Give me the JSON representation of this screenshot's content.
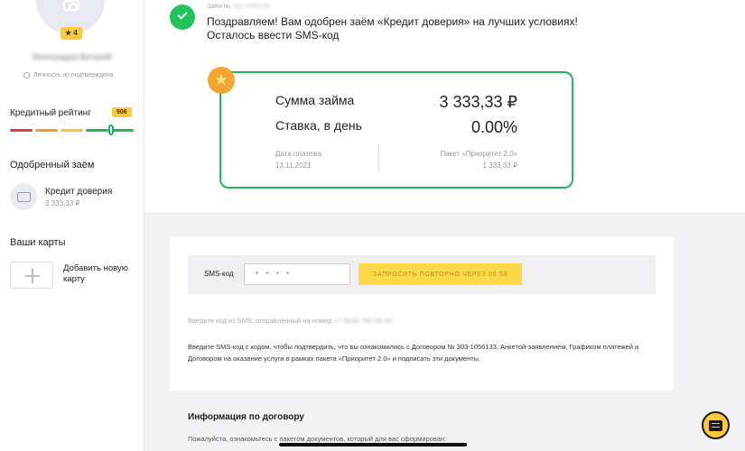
{
  "sidebar": {
    "rating_stars": "★ 4",
    "user_name": "Виноградов Виталий",
    "verify_status": "Личность не подтверждена",
    "credit_rating": {
      "label": "Кредитный рейтинг",
      "value": "906",
      "level": 0.82
    },
    "rating_colors": [
      "#e23b3b",
      "#f39a2b",
      "#f6c33a",
      "#22b85a",
      "#22b85a"
    ],
    "approved_section": "Одобренный заём",
    "approved_loan": {
      "name": "Кредит доверия",
      "amount": "3 333,33 ₽"
    },
    "cards_section": "Ваши карты",
    "add_card": "Добавить новую карту"
  },
  "header": {
    "loan_no_label": "Заём №",
    "loan_no_value": "302-1056133",
    "message": "Поздравляем! Вам одобрен заём «Кредит доверия» на лучших условиях! Осталось ввести SMS-код"
  },
  "loan_card": {
    "sum_label": "Сумма займа",
    "sum_value": "3 333,33 ₽",
    "rate_label": "Ставка, в день",
    "rate_value": "0.00%",
    "date_label": "Дата платежа",
    "date_value": "13.11.2021",
    "package_label": "Пакет «Приоритет 2.0»",
    "package_value": "1 333,33 ₽"
  },
  "sms": {
    "label": "SMS-код",
    "placeholder": "* * * *",
    "resend": "ЗАПРОСИТЬ ПОВТОРНО ЧЕРЕЗ 00:58",
    "hint": "Введите код из SMS, отправленный на номер",
    "phone": "+7 (916) 760-00-00",
    "description": "Введите SMS-код с кодом, чтобы подтвердить, что вы ознакомились с Договором № 303-1056133, Анкетой-заявлением, Графиком платежей и Договором на оказание услуги в рамках пакета «Приоритет 2.0» и подписать эти документы."
  },
  "info": {
    "title": "Информация по договору",
    "subtitle": "Пожалуйста, ознакомьтесь с пакетом документов, который для вас сформирован:"
  },
  "colors": {
    "accent_green": "#22b85a",
    "accent_yellow": "#ffc93c"
  }
}
